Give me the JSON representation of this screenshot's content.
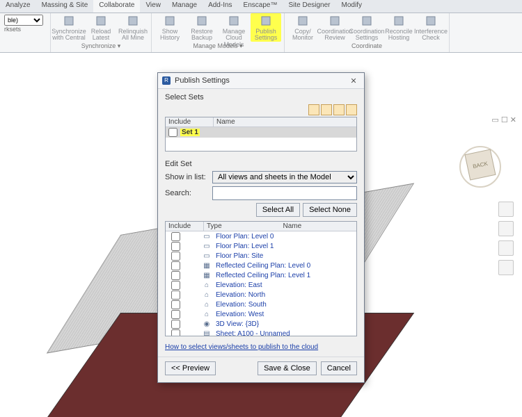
{
  "ribbon_tabs": [
    "Analyze",
    "Massing & Site",
    "Collaborate",
    "View",
    "Manage",
    "Add-Ins",
    "Enscape™",
    "Site Designer",
    "Modify"
  ],
  "active_tab_index": 2,
  "worksets": {
    "label": "rksets",
    "dropdown": "ble)"
  },
  "panels": [
    {
      "name": "Synchronize ▾",
      "buttons": [
        {
          "label": "Synchronize with Central"
        },
        {
          "label": "Reload Latest"
        },
        {
          "label": "Relinquish All Mine"
        }
      ]
    },
    {
      "name": "Manage Models ▾",
      "buttons": [
        {
          "label": "Show History"
        },
        {
          "label": "Restore Backup"
        },
        {
          "label": "Manage Cloud Models"
        },
        {
          "label": "Publish Settings",
          "highlight": true
        }
      ]
    },
    {
      "name": "Coordinate",
      "buttons": [
        {
          "label": "Copy/ Monitor"
        },
        {
          "label": "Coordination Review"
        },
        {
          "label": "Coordination Settings"
        },
        {
          "label": "Reconcile Hosting"
        },
        {
          "label": "Interference Check"
        }
      ]
    }
  ],
  "viewcube": {
    "face": "BACK"
  },
  "dialog": {
    "title": "Publish Settings",
    "select_sets_label": "Select Sets",
    "sets_headers": {
      "include": "Include",
      "name": "Name"
    },
    "sets": [
      {
        "name": "Set 1",
        "checked": false,
        "highlight": true
      }
    ],
    "edit_set_label": "Edit Set",
    "show_in_list_label": "Show in list:",
    "show_in_list_value": "All views and sheets in the Model",
    "search_label": "Search:",
    "search_value": "",
    "select_all": "Select All",
    "select_none": "Select None",
    "views_headers": {
      "include": "Include",
      "type": "Type",
      "name": "Name"
    },
    "views": [
      {
        "icon": "plan",
        "name": "Floor Plan: Level 0"
      },
      {
        "icon": "plan",
        "name": "Floor Plan: Level 1"
      },
      {
        "icon": "plan",
        "name": "Floor Plan: Site"
      },
      {
        "icon": "rcp",
        "name": "Reflected Ceiling Plan: Level 0"
      },
      {
        "icon": "rcp",
        "name": "Reflected Ceiling Plan: Level 1"
      },
      {
        "icon": "elev",
        "name": "Elevation: East"
      },
      {
        "icon": "elev",
        "name": "Elevation: North"
      },
      {
        "icon": "elev",
        "name": "Elevation: South"
      },
      {
        "icon": "elev",
        "name": "Elevation: West"
      },
      {
        "icon": "3d",
        "name": "3D View: {3D}"
      },
      {
        "icon": "sheet",
        "name": "Sheet: A100 - Unnamed"
      }
    ],
    "help_link": "How to select views/sheets to publish to the cloud",
    "preview_btn": "<< Preview",
    "save_btn": "Save & Close",
    "cancel_btn": "Cancel"
  }
}
